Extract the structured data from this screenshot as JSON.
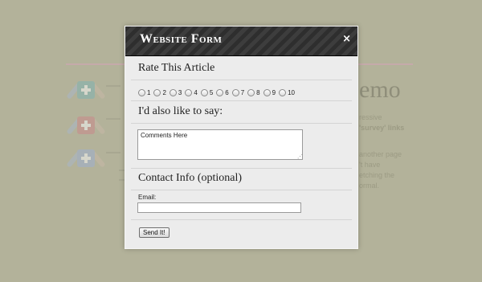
{
  "modal": {
    "title": "Website Form",
    "close_glyph": "×",
    "close_icon": "close-icon"
  },
  "rating": {
    "heading": "Rate This Article",
    "options": [
      "1",
      "2",
      "3",
      "4",
      "5",
      "6",
      "7",
      "8",
      "9",
      "10"
    ],
    "selected": null
  },
  "comments": {
    "heading": "I'd also like to say:",
    "value": "Comments Here"
  },
  "contact": {
    "heading": "Contact Info (optional)",
    "email_label": "Email:",
    "email_value": ""
  },
  "submit": {
    "label": "Send It!"
  },
  "background": {
    "title_fragment": "emo",
    "lines": [
      "ressive",
      "'survey' links",
      "another page",
      "'t have",
      "etching the",
      "ormal."
    ],
    "colors": {
      "page": "#b3b29a",
      "icon_teal": "#7fb3b3",
      "icon_red": "#c98a8a",
      "icon_blue": "#9fb0d0"
    }
  }
}
